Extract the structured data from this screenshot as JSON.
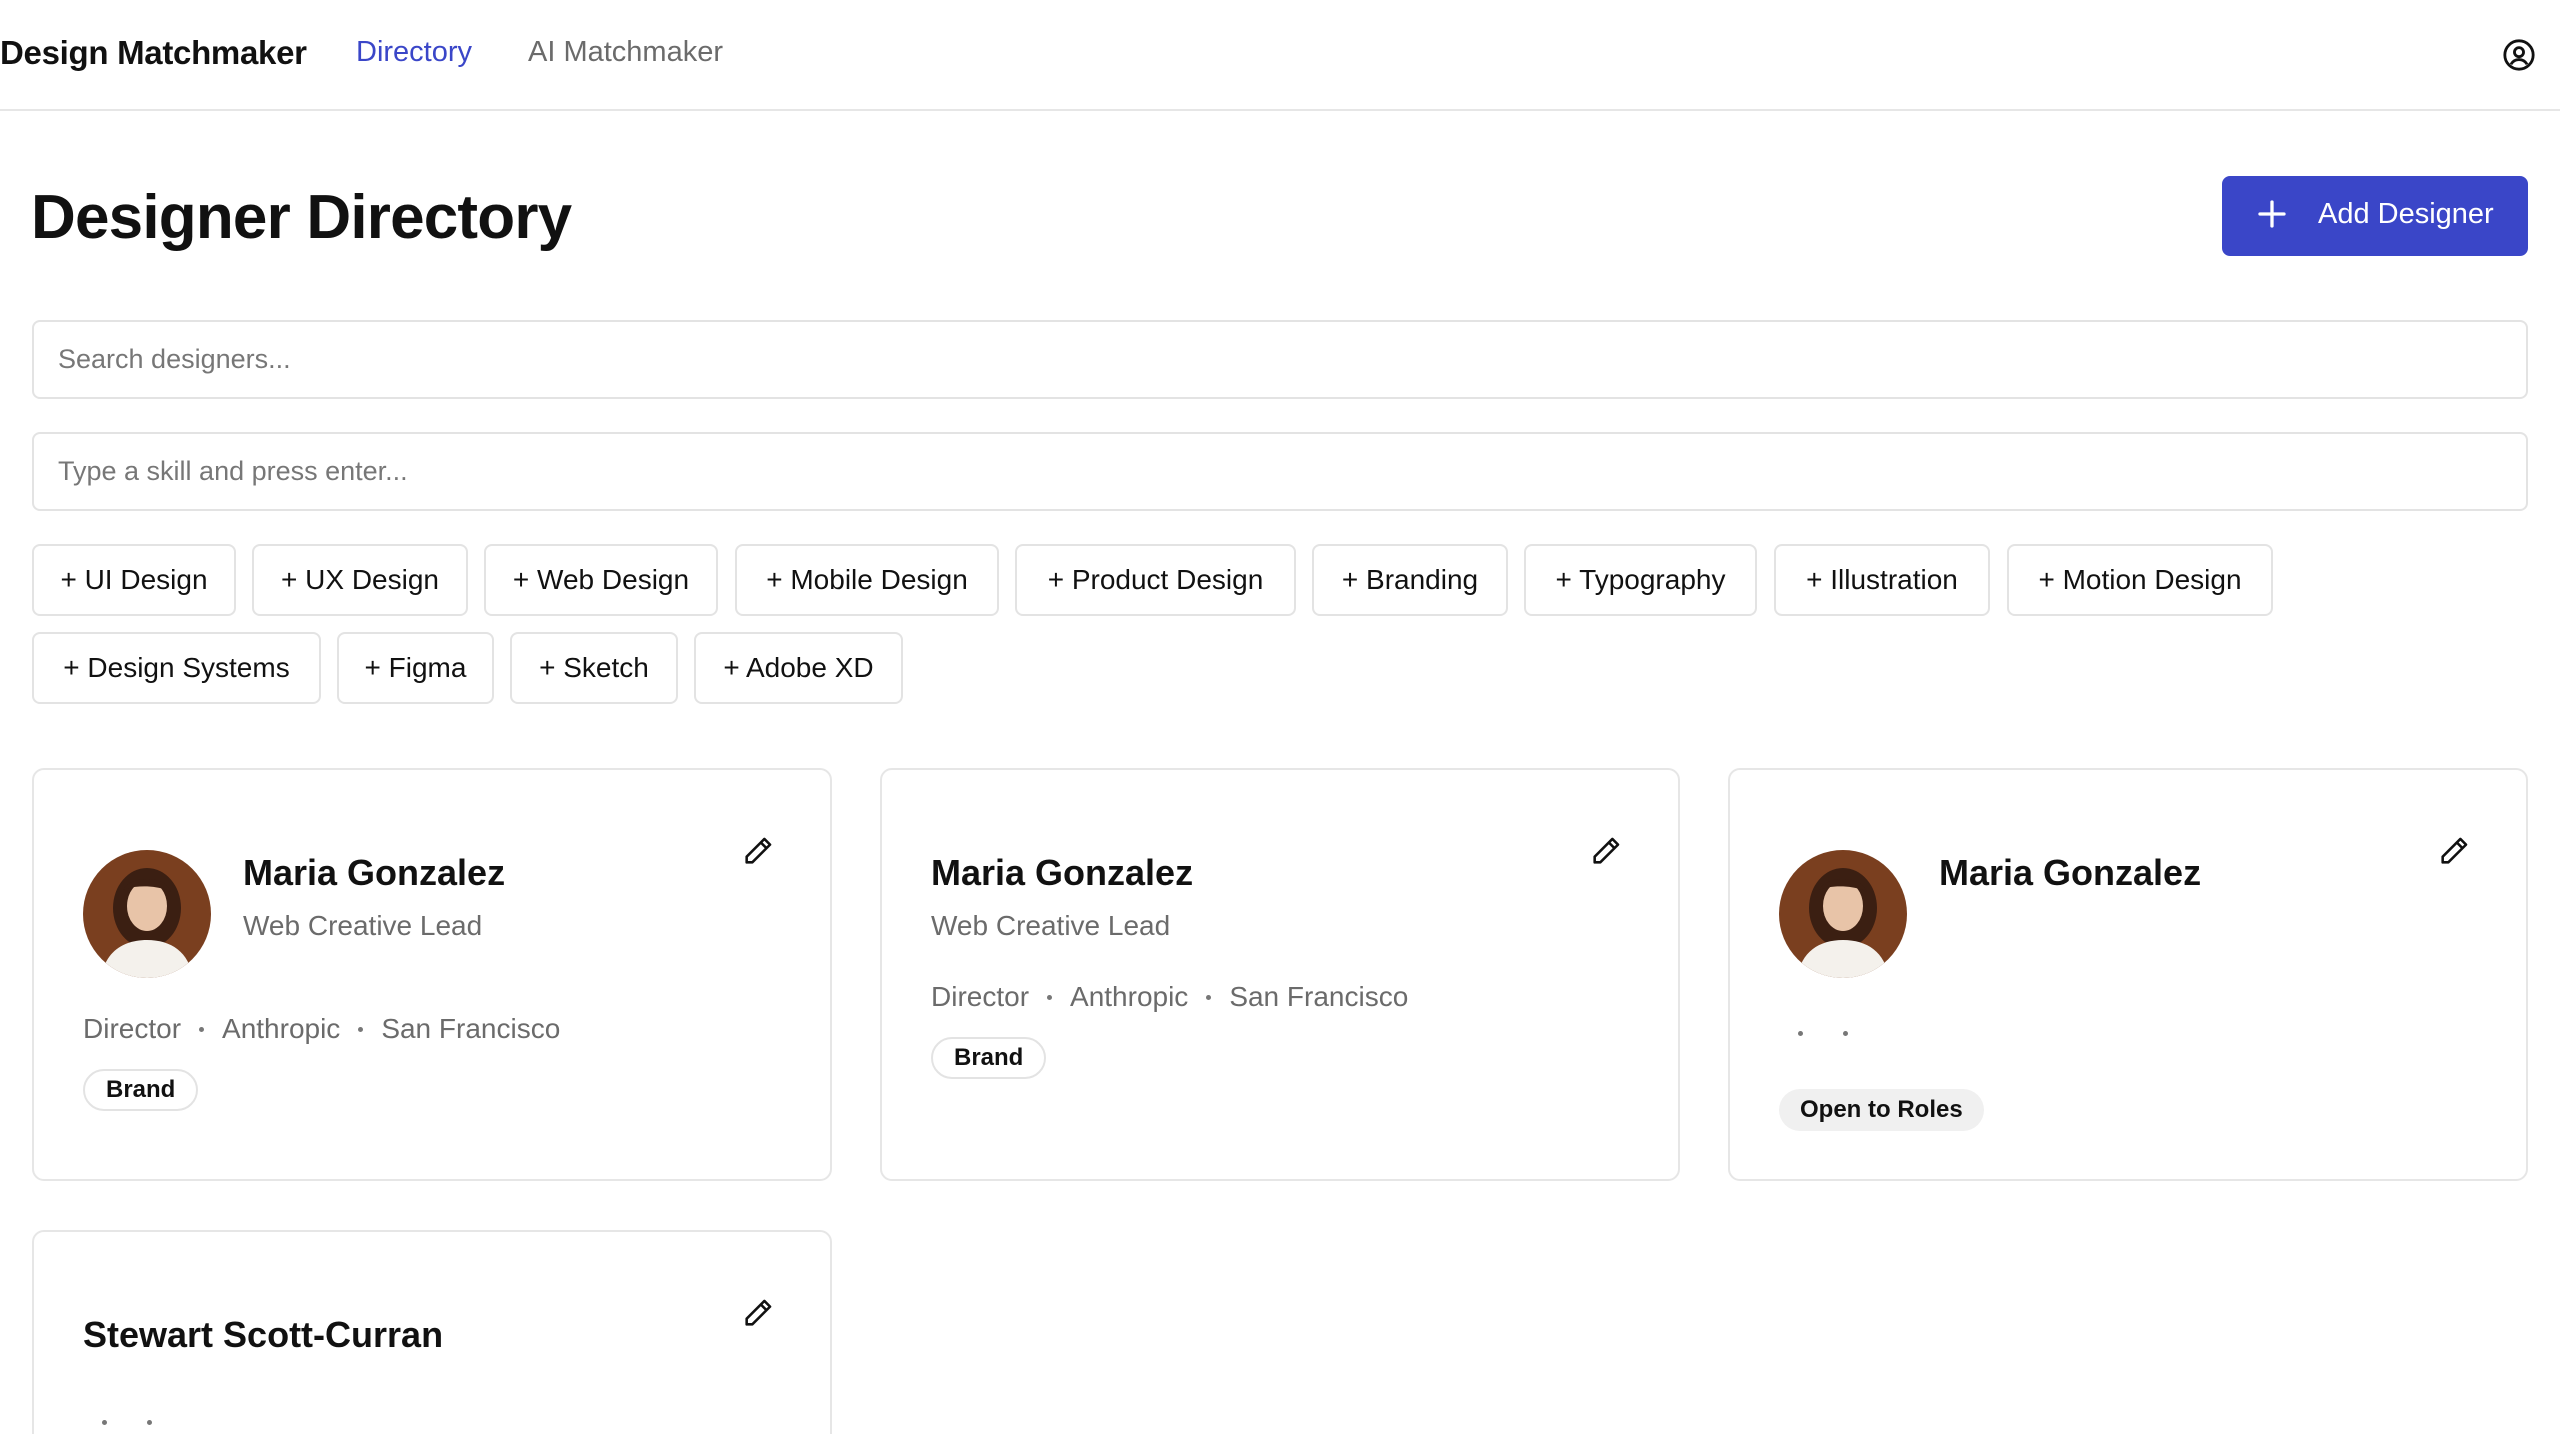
{
  "nav": {
    "brand": "Design Matchmaker",
    "links": [
      {
        "label": "Directory",
        "active": true
      },
      {
        "label": "AI Matchmaker",
        "active": false
      }
    ],
    "profile_icon": "user-circle-icon"
  },
  "header": {
    "title": "Designer Directory",
    "add_button_label": "Add Designer",
    "add_button_icon": "plus-icon"
  },
  "search": {
    "placeholder": "Search designers...",
    "value": ""
  },
  "skill_input": {
    "placeholder": "Type a skill and press enter...",
    "value": ""
  },
  "skill_chips": [
    "+ UI Design",
    "+ UX Design",
    "+ Web Design",
    "+ Mobile Design",
    "+ Product Design",
    "+ Branding",
    "+ Typography",
    "+ Illustration",
    "+ Motion Design",
    "+ Design Systems",
    "+ Figma",
    "+ Sketch",
    "+ Adobe XD"
  ],
  "cards": [
    {
      "name": "Maria Gonzalez",
      "role": "Web Creative Lead",
      "level": "Director",
      "company": "Anthropic",
      "location": "San Francisco",
      "tags": [
        "Brand"
      ],
      "has_avatar": true
    },
    {
      "name": "Maria Gonzalez",
      "role": "Web Creative Lead",
      "level": "Director",
      "company": "Anthropic",
      "location": "San Francisco",
      "tags": [
        "Brand"
      ],
      "has_avatar": false
    },
    {
      "name": "Maria Gonzalez",
      "role": "",
      "level": "",
      "company": "",
      "location": "",
      "tags": [
        "Open to Roles"
      ],
      "has_avatar": true
    },
    {
      "name": "Stewart Scott-Curran",
      "role": "",
      "level": "",
      "company": "",
      "location": "",
      "tags": [],
      "has_avatar": false
    }
  ],
  "colors": {
    "accent": "#3a46c8",
    "border": "#e3e3e3",
    "muted_text": "#6b6b6b",
    "avatar_bg": "#7a3f1f"
  },
  "icons": {
    "edit": "pencil-icon",
    "avatar": "avatar-photo"
  }
}
